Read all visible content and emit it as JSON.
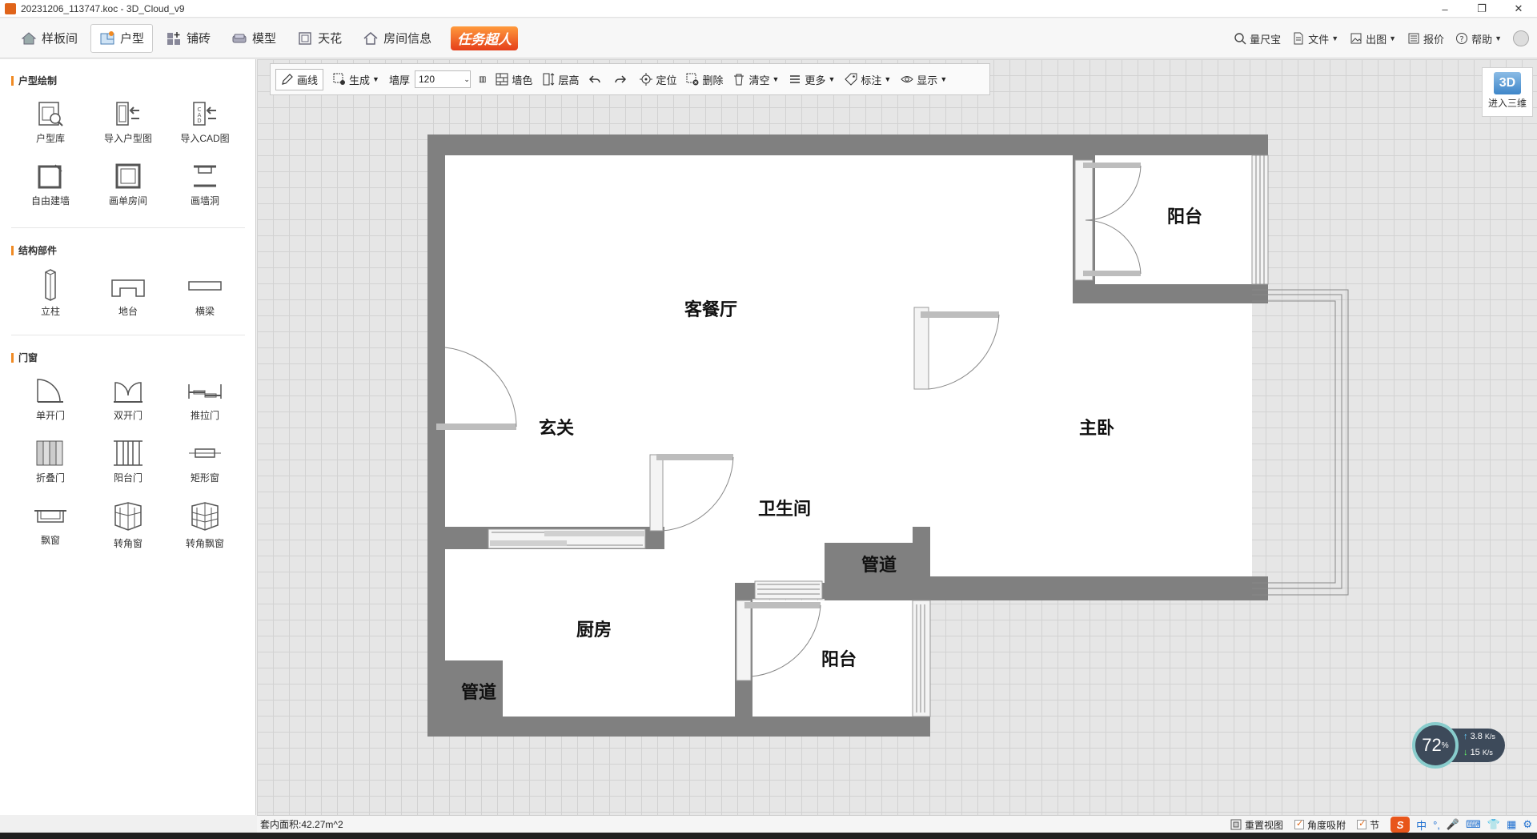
{
  "window": {
    "title": "20231206_113747.koc - 3D_Cloud_v9"
  },
  "nav": {
    "tabs": [
      {
        "label": "样板间"
      },
      {
        "label": "户型"
      },
      {
        "label": "铺砖"
      },
      {
        "label": "模型"
      },
      {
        "label": "天花"
      },
      {
        "label": "房间信息"
      }
    ],
    "promo": "任务超人",
    "right": {
      "measure": "量尺宝",
      "file": "文件",
      "export": "出图",
      "quote": "报价",
      "help": "帮助"
    }
  },
  "left": {
    "sections": {
      "layout": "户型绘制",
      "structure": "结构部件",
      "doors": "门窗"
    },
    "layout_tools": [
      "户型库",
      "导入户型图",
      "导入CAD图",
      "自由建墙",
      "画单房间",
      "画墙洞"
    ],
    "structure_tools": [
      "立柱",
      "地台",
      "横梁"
    ],
    "door_tools": [
      "单开门",
      "双开门",
      "推拉门",
      "折叠门",
      "阳台门",
      "矩形窗",
      "飘窗",
      "转角窗",
      "转角飘窗"
    ]
  },
  "draw_toolbar": {
    "draw_line": "画线",
    "generate": "生成",
    "wall_thick_label": "墙厚",
    "wall_thick_value": "120",
    "wall_color": "墙色",
    "floor_height": "层高",
    "locate": "定位",
    "delete": "删除",
    "clear": "清空",
    "more": "更多",
    "annotate": "标注",
    "display": "显示"
  },
  "view3d": {
    "label": "进入三维",
    "badge": "3D"
  },
  "rooms": {
    "living": "客餐厅",
    "entry": "玄关",
    "balcony_top": "阳台",
    "master": "主卧",
    "bath": "卫生间",
    "duct_mid": "管道",
    "kitchen": "厨房",
    "duct_kitchen": "管道",
    "balcony_bottom": "阳台"
  },
  "status": {
    "area": "套内面积:42.27m^2",
    "reset_view": "重置视图",
    "angle_snap": "角度吸附",
    "truncated": "节"
  },
  "network": {
    "percent": "72",
    "up": "3.8",
    "down": "15",
    "unit": "K/s"
  },
  "ime": {
    "logo": "S",
    "lang": "中"
  }
}
